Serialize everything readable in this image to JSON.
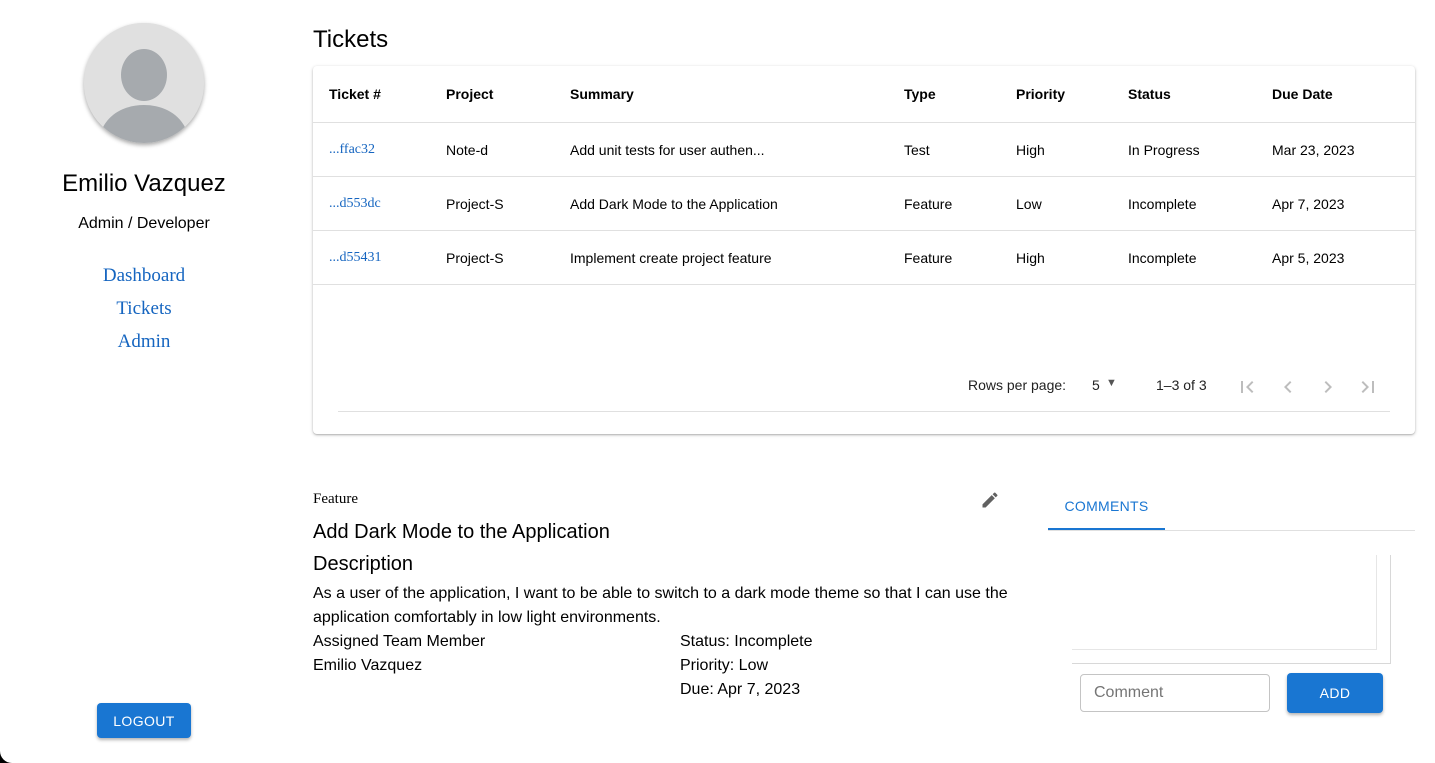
{
  "sidebar": {
    "user_name": "Emilio Vazquez",
    "user_role": "Admin / Developer",
    "nav": [
      {
        "label": "Dashboard"
      },
      {
        "label": "Tickets"
      },
      {
        "label": "Admin"
      }
    ],
    "logout_label": "LOGOUT"
  },
  "tickets": {
    "title": "Tickets",
    "columns": [
      "Ticket #",
      "Project",
      "Summary",
      "Type",
      "Priority",
      "Status",
      "Due Date"
    ],
    "rows": [
      [
        "...ffac32",
        "Note-d",
        "Add unit tests for user authen...",
        "Test",
        "High",
        "In Progress",
        "Mar 23, 2023"
      ],
      [
        "...d553dc",
        "Project-S",
        "Add Dark Mode to the Application",
        "Feature",
        "Low",
        "Incomplete",
        "Apr 7, 2023"
      ],
      [
        "...d55431",
        "Project-S",
        "Implement create project feature",
        "Feature",
        "High",
        "Incomplete",
        "Apr 5, 2023"
      ]
    ],
    "pagination": {
      "rows_per_page_label": "Rows per page:",
      "rows_per_page": "5",
      "range": "1–3 of 3"
    }
  },
  "detail": {
    "type": "Feature",
    "title": "Add Dark Mode to the Application",
    "description_heading": "Description",
    "description": "As a user of the application, I want to be able to switch to a dark mode theme so that I can use the application comfortably in low light environments.",
    "assigned_label": "Assigned Team Member",
    "assigned_name": "Emilio Vazquez",
    "status": "Status: Incomplete",
    "priority": "Priority: Low",
    "due": "Due: Apr 7, 2023"
  },
  "comments": {
    "tab_label": "COMMENTS",
    "input_placeholder": "Comment",
    "add_label": "ADD"
  },
  "colors": {
    "primary": "#1976d2",
    "link": "#1565c0",
    "avatar_bg": "#e0e0e0",
    "avatar_fg": "#a6aaae"
  }
}
